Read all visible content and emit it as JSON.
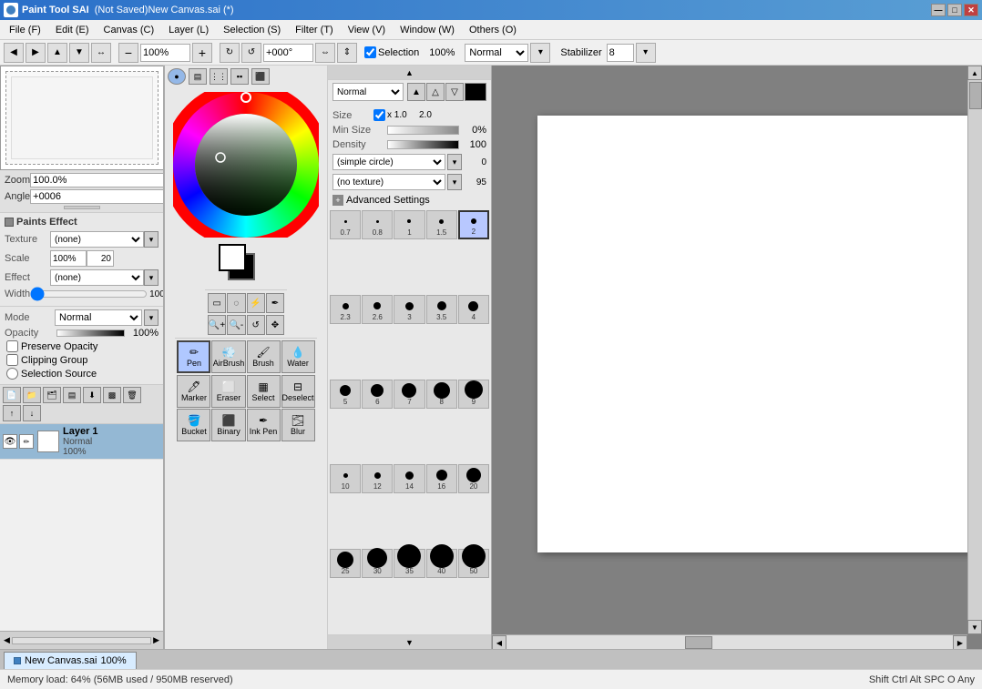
{
  "titlebar": {
    "title": "(Not Saved)New Canvas.sai (*)",
    "app": "Paint Tool SAI",
    "min_btn": "—",
    "max_btn": "□",
    "close_btn": "✕"
  },
  "menubar": {
    "items": [
      {
        "id": "file",
        "label": "File (F)"
      },
      {
        "id": "edit",
        "label": "Edit (E)"
      },
      {
        "id": "canvas",
        "label": "Canvas (C)"
      },
      {
        "id": "layer",
        "label": "Layer (L)"
      },
      {
        "id": "selection",
        "label": "Selection (S)"
      },
      {
        "id": "filter",
        "label": "Filter (T)"
      },
      {
        "id": "view",
        "label": "View (V)"
      },
      {
        "id": "window",
        "label": "Window (W)"
      },
      {
        "id": "others",
        "label": "Others (O)"
      }
    ]
  },
  "toolbar": {
    "zoom": "100%",
    "rotation": "+000°",
    "selection_label": "Selection",
    "selection_checked": true,
    "blend_mode": "Normal",
    "stabilizer_label": "Stabilizer",
    "stabilizer_value": "8"
  },
  "zoom_panel": {
    "zoom_label": "Zoom",
    "zoom_value": "100.0%",
    "angle_label": "Angle",
    "angle_value": "+0006"
  },
  "paints_effect": {
    "title": "Paints Effect",
    "texture_label": "Texture",
    "texture_value": "(none)",
    "scale_label": "Scale",
    "scale_value": "100%",
    "scale_num": "20",
    "effect_label": "Effect",
    "effect_value": "(none)",
    "width_label": "Width",
    "width_min": "1",
    "width_max": "100"
  },
  "mode_area": {
    "mode_label": "Mode",
    "mode_value": "Normal",
    "opacity_label": "Opacity",
    "opacity_value": "100%",
    "preserve_opacity": "Preserve Opacity",
    "clipping_group": "Clipping Group",
    "selection_source": "Selection Source"
  },
  "layer_panel": {
    "layer_name": "Layer 1",
    "layer_mode": "Normal",
    "layer_opacity": "100%"
  },
  "brush_panel": {
    "mode": "Normal",
    "size_label": "Size",
    "size_check": true,
    "size_min": "x 1.0",
    "size_max": "2.0",
    "min_size_label": "Min Size",
    "min_size_value": "0%",
    "density_label": "Density",
    "density_value": "100",
    "shape_label": "(simple circle)",
    "shape_num": "0",
    "texture_label": "(no texture)",
    "texture_num": "95",
    "adv_settings": "Advanced Settings"
  },
  "brush_presets": [
    {
      "size": 0.7,
      "label": "0.7",
      "dot_size": 3
    },
    {
      "size": 0.8,
      "label": "0.8",
      "dot_size": 3
    },
    {
      "size": 1,
      "label": "1",
      "dot_size": 4
    },
    {
      "size": 1.5,
      "label": "1.5",
      "dot_size": 5
    },
    {
      "size": 2,
      "label": "2",
      "dot_size": 6,
      "selected": true
    },
    {
      "size": 2.3,
      "label": "2.3",
      "dot_size": 7
    },
    {
      "size": 2.6,
      "label": "2.6",
      "dot_size": 8
    },
    {
      "size": 3,
      "label": "3",
      "dot_size": 9
    },
    {
      "size": 3.5,
      "label": "3.5",
      "dot_size": 10
    },
    {
      "size": 4,
      "label": "4",
      "dot_size": 11
    },
    {
      "size": 5,
      "label": "5",
      "dot_size": 12
    },
    {
      "size": 6,
      "label": "6",
      "dot_size": 14
    },
    {
      "size": 7,
      "label": "7",
      "dot_size": 16
    },
    {
      "size": 8,
      "label": "8",
      "dot_size": 18
    },
    {
      "size": 9,
      "label": "9",
      "dot_size": 20
    },
    {
      "size": 10,
      "label": "10",
      "dot_size": 5
    },
    {
      "size": 12,
      "label": "12",
      "dot_size": 7
    },
    {
      "size": 14,
      "label": "14",
      "dot_size": 9
    },
    {
      "size": 16,
      "label": "16",
      "dot_size": 12
    },
    {
      "size": 20,
      "label": "20",
      "dot_size": 16
    },
    {
      "size": 25,
      "label": "25",
      "dot_size": 18
    },
    {
      "size": 30,
      "label": "30",
      "dot_size": 22
    },
    {
      "size": 35,
      "label": "35",
      "dot_size": 26
    },
    {
      "size": 40,
      "label": "40",
      "dot_size": 28
    },
    {
      "size": 50,
      "label": "50",
      "dot_size": 30
    }
  ],
  "tool_types": [
    {
      "id": "pen",
      "label": "Pen",
      "active": true
    },
    {
      "id": "airbrush",
      "label": "AirBrush"
    },
    {
      "id": "brush",
      "label": "Brush"
    },
    {
      "id": "water",
      "label": "Water"
    },
    {
      "id": "marker",
      "label": "Marker"
    },
    {
      "id": "eraser",
      "label": "Eraser"
    },
    {
      "id": "select",
      "label": "Select"
    },
    {
      "id": "deselect",
      "label": "Deselect"
    },
    {
      "id": "bucket",
      "label": "Bucket"
    },
    {
      "id": "binary",
      "label": "Binary"
    },
    {
      "id": "ink-pen",
      "label": "Ink Pen"
    },
    {
      "id": "blur",
      "label": "Blur"
    }
  ],
  "selection_tools": [
    {
      "id": "rect-select",
      "symbol": "▭"
    },
    {
      "id": "lasso-select",
      "symbol": "◌"
    },
    {
      "id": "magic-select",
      "symbol": "⚡"
    },
    {
      "id": "pen-select",
      "symbol": "✏"
    }
  ],
  "statusbar": {
    "memory_label": "Memory load: 64% (56MB used / 950MB reserved)",
    "keys_label": "Shift Ctrl Alt SPC O Any"
  },
  "tab": {
    "label": "New Canvas.sai",
    "zoom": "100%"
  }
}
